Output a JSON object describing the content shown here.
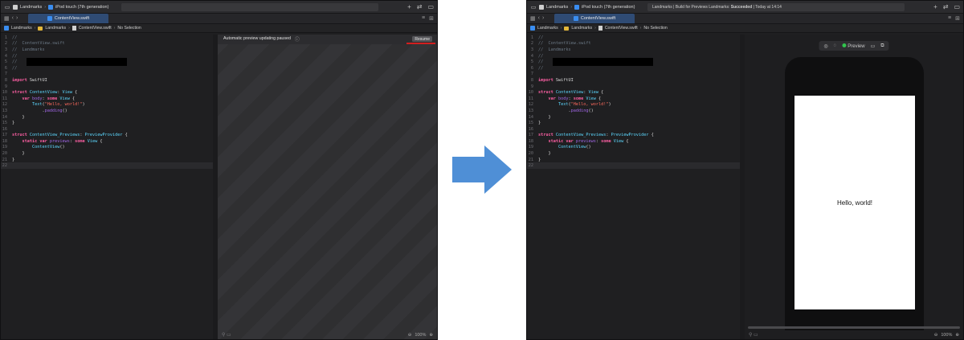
{
  "arrow_color": "#4f8fd6",
  "left": {
    "toolbar": {
      "project": "Landmarks",
      "device": "iPod touch (7th generation)",
      "activity": ""
    },
    "tab": {
      "label": "ContentView.swift"
    },
    "jump": {
      "items": [
        "Landmarks",
        "Landmarks",
        "ContentView.swift",
        "No Selection"
      ]
    },
    "preview": {
      "paused_text": "Automatic preview updating paused",
      "resume_label": "Resume",
      "zoom": "100%"
    }
  },
  "right": {
    "toolbar": {
      "project": "Landmarks",
      "device": "iPod touch (7th generation)",
      "activity_prefix": "Landmarks | Build for Previews Landmarks:",
      "activity_status": "Succeeded",
      "activity_time": "| Today at 14:14"
    },
    "tab": {
      "label": "ContentView.swift"
    },
    "jump": {
      "items": [
        "Landmarks",
        "Landmarks",
        "ContentView.swift",
        "No Selection"
      ]
    },
    "preview": {
      "mode_label": "Preview",
      "canvas_text": "Hello, world!",
      "zoom": "100%"
    }
  },
  "code_lines": [
    {
      "n": "1",
      "parts": [
        [
          "c",
          "//"
        ]
      ]
    },
    {
      "n": "2",
      "parts": [
        [
          "c",
          "//  ContentView.swift"
        ]
      ]
    },
    {
      "n": "3",
      "parts": [
        [
          "c",
          "//  Landmarks"
        ]
      ]
    },
    {
      "n": "4",
      "parts": [
        [
          "c",
          "//"
        ]
      ]
    },
    {
      "n": "5",
      "parts": [
        [
          "c",
          "//"
        ]
      ],
      "redacted": true
    },
    {
      "n": "6",
      "parts": [
        [
          "c",
          "//"
        ]
      ]
    },
    {
      "n": "7",
      "parts": [
        [
          "t",
          ""
        ]
      ]
    },
    {
      "n": "8",
      "parts": [
        [
          "k",
          "import"
        ],
        [
          "t",
          " SwiftUI"
        ]
      ]
    },
    {
      "n": "9",
      "parts": [
        [
          "t",
          ""
        ]
      ]
    },
    {
      "n": "10",
      "parts": [
        [
          "k",
          "struct"
        ],
        [
          "t",
          " "
        ],
        [
          "y",
          "ContentView"
        ],
        [
          "t",
          ": "
        ],
        [
          "y",
          "View"
        ],
        [
          "t",
          " {"
        ]
      ]
    },
    {
      "n": "11",
      "parts": [
        [
          "t",
          "    "
        ],
        [
          "k",
          "var"
        ],
        [
          "t",
          " "
        ],
        [
          "f",
          "body"
        ],
        [
          "t",
          ": "
        ],
        [
          "k",
          "some"
        ],
        [
          "t",
          " "
        ],
        [
          "y",
          "View"
        ],
        [
          "t",
          " {"
        ]
      ]
    },
    {
      "n": "12",
      "parts": [
        [
          "t",
          "        "
        ],
        [
          "y",
          "Text"
        ],
        [
          "t",
          "("
        ],
        [
          "s",
          "\"Hello, world!\""
        ],
        [
          "t",
          ")"
        ]
      ]
    },
    {
      "n": "13",
      "parts": [
        [
          "t",
          "            ."
        ],
        [
          "f",
          "padding"
        ],
        [
          "t",
          "()"
        ]
      ]
    },
    {
      "n": "14",
      "parts": [
        [
          "t",
          "    }"
        ]
      ]
    },
    {
      "n": "15",
      "parts": [
        [
          "t",
          "}"
        ]
      ]
    },
    {
      "n": "16",
      "parts": [
        [
          "t",
          ""
        ]
      ]
    },
    {
      "n": "17",
      "parts": [
        [
          "k",
          "struct"
        ],
        [
          "t",
          " "
        ],
        [
          "y",
          "ContentView_Previews"
        ],
        [
          "t",
          ": "
        ],
        [
          "y",
          "PreviewProvider"
        ],
        [
          "t",
          " {"
        ]
      ]
    },
    {
      "n": "18",
      "parts": [
        [
          "t",
          "    "
        ],
        [
          "k",
          "static"
        ],
        [
          "t",
          " "
        ],
        [
          "k",
          "var"
        ],
        [
          "t",
          " "
        ],
        [
          "f",
          "previews"
        ],
        [
          "t",
          ": "
        ],
        [
          "k",
          "some"
        ],
        [
          "t",
          " "
        ],
        [
          "y",
          "View"
        ],
        [
          "t",
          " {"
        ]
      ]
    },
    {
      "n": "19",
      "parts": [
        [
          "t",
          "        "
        ],
        [
          "y",
          "ContentView"
        ],
        [
          "t",
          "()"
        ]
      ]
    },
    {
      "n": "20",
      "parts": [
        [
          "t",
          "    }"
        ]
      ]
    },
    {
      "n": "21",
      "parts": [
        [
          "t",
          "}"
        ]
      ]
    },
    {
      "n": "22",
      "parts": [
        [
          "t",
          ""
        ]
      ],
      "current": true
    }
  ]
}
